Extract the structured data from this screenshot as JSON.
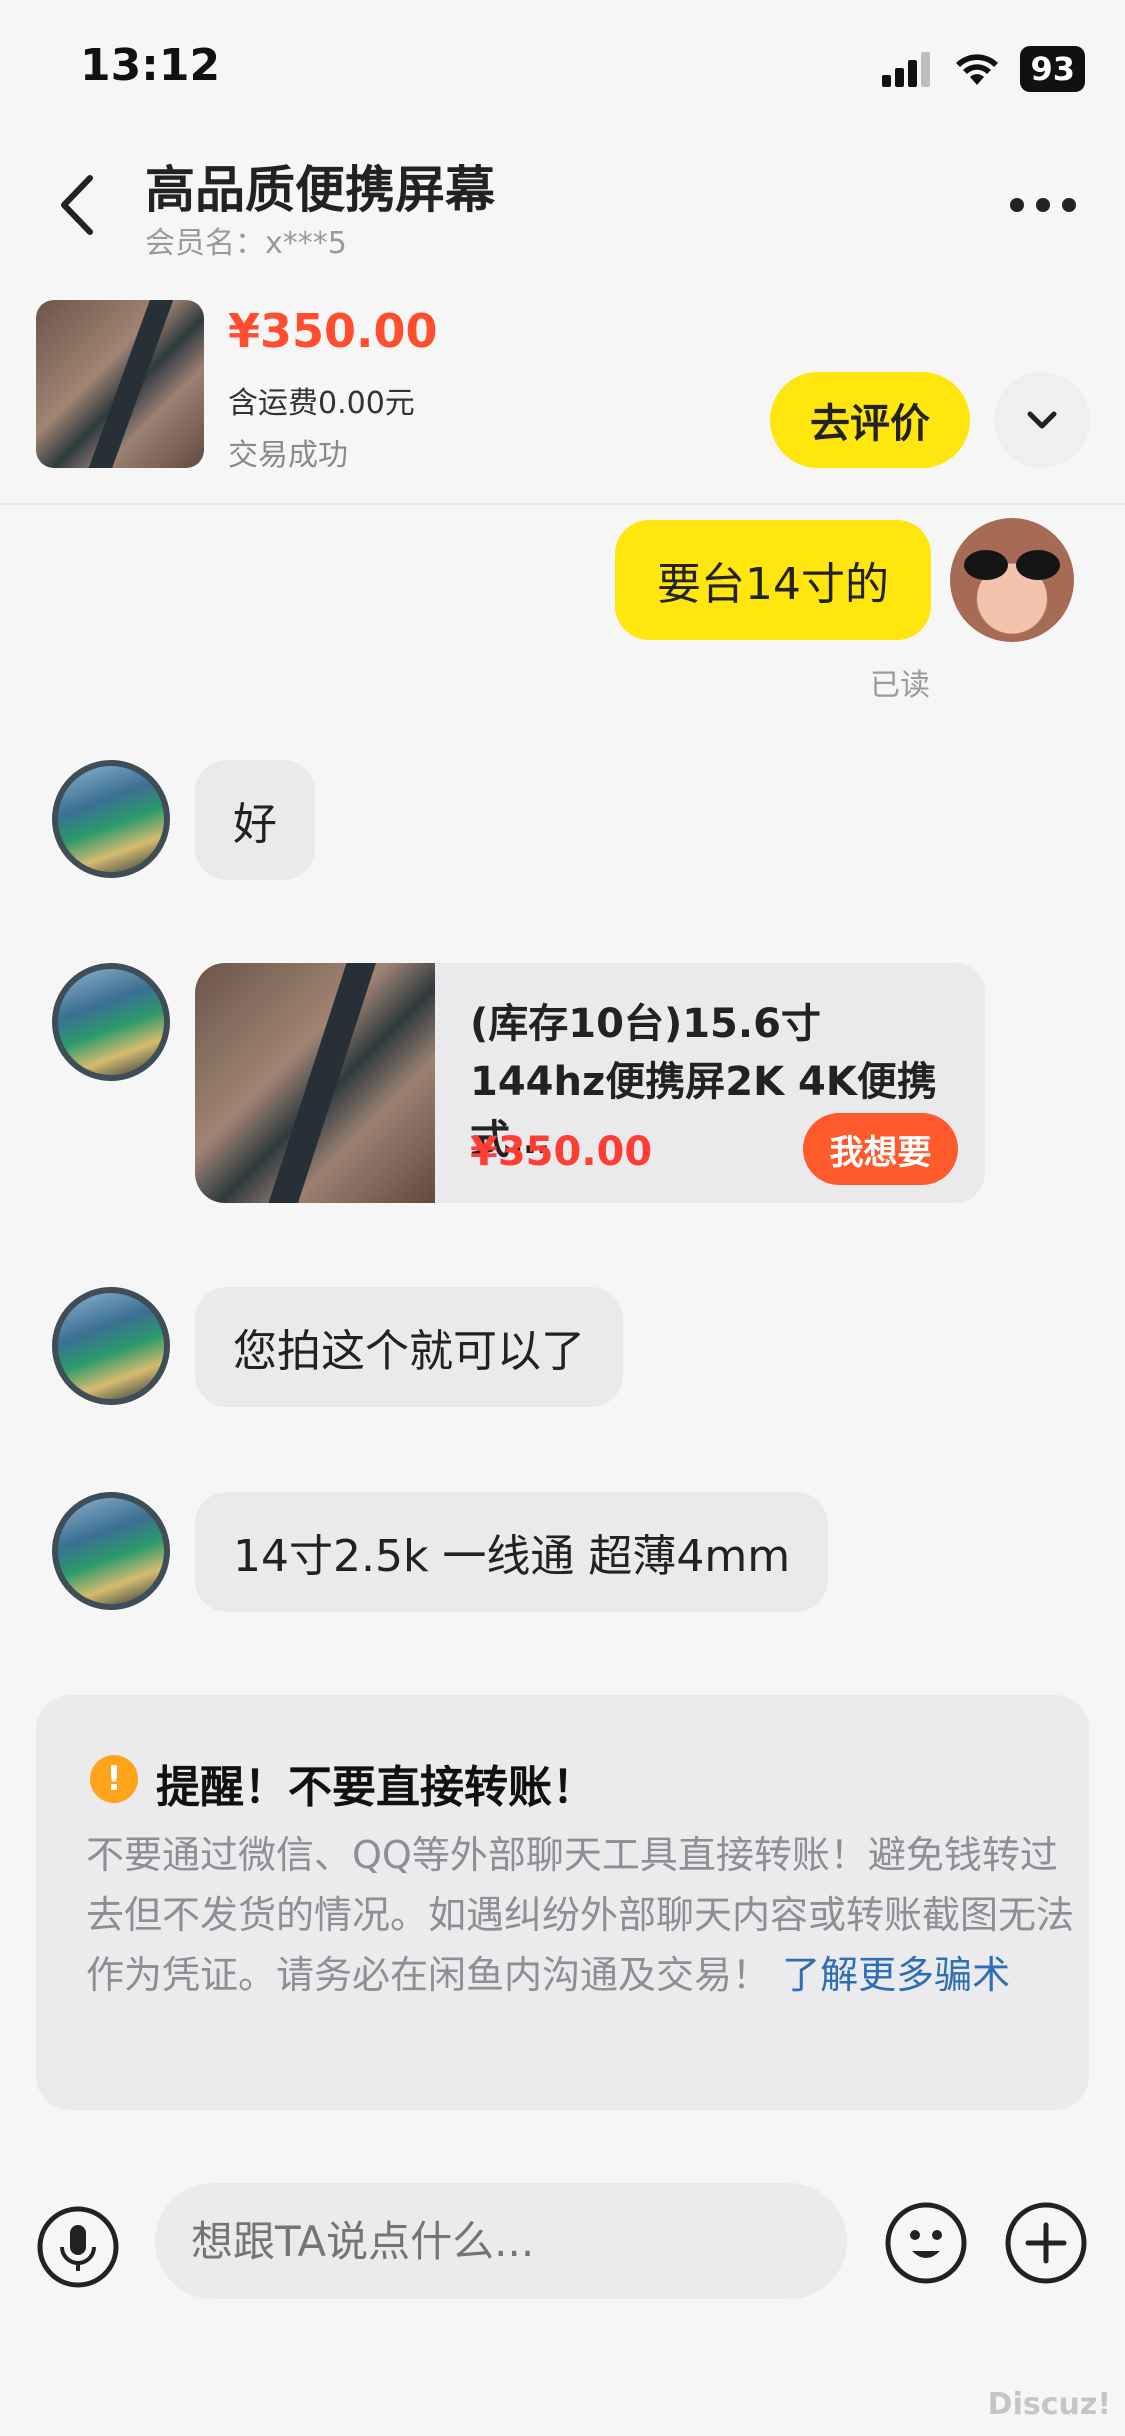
{
  "status_bar": {
    "time": "13:12",
    "battery": "93"
  },
  "nav": {
    "title": "高品质便携屏幕",
    "member": "会员名：x***5"
  },
  "product": {
    "price": "¥350.00",
    "shipping": "含运费0.00元",
    "status": "交易成功",
    "review_label": "去评价"
  },
  "messages": [
    {
      "from": "self",
      "text": "要台14寸的",
      "read": "已读"
    },
    {
      "from": "other",
      "text": "好"
    },
    {
      "from": "other",
      "type": "product-card",
      "title": "(库存10台)15.6寸144hz便携屏2K 4K便携式…",
      "price": "¥350.00",
      "button": "我想要"
    },
    {
      "from": "other",
      "text": "您拍这个就可以了"
    },
    {
      "from": "other",
      "text": "14寸2.5k 一线通 超薄4mm"
    }
  ],
  "warning": {
    "title": "提醒！不要直接转账！",
    "body": "不要通过微信、QQ等外部聊天工具直接转账！避免钱转过去但不发货的情况。如遇纠纷外部聊天内容或转账截图无法作为凭证。请务必在闲鱼内沟通及交易！",
    "link": "了解更多骗术"
  },
  "input": {
    "placeholder": "想跟TA说点什么..."
  },
  "watermark": "Discuz!",
  "colors": {
    "accent": "#ffe60f",
    "price": "#ff4d2e",
    "link": "#2f6eb5"
  }
}
